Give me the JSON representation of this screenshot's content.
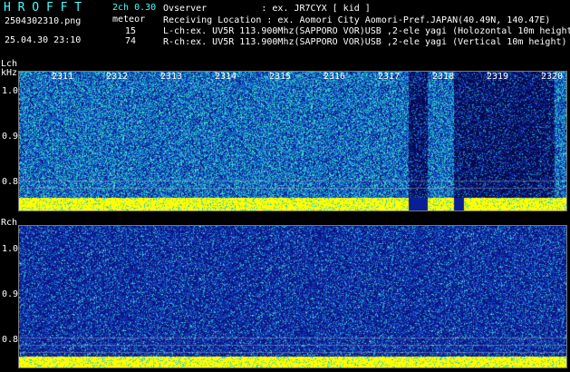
{
  "header": {
    "logo": "H R O F F T",
    "channel_version": "2ch 0.30",
    "mode_label": "meteor",
    "filename": "2504302310.png",
    "datetime": "25.04.30 23:10",
    "count_l": "15",
    "count_r": "74",
    "observer": "Ovserver          : ex. JR7CYX [ kid ]",
    "location": "Receiving Location : ex. Aomori City Aomori-Pref.JAPAN(40.49N, 140.47E)",
    "lch_info": "L-ch:ex. UV5R 113.900Mhz(SAPPORO VOR)USB ,2-ele yagi (Holozontal 10m height",
    "rch_info": "R-ch:ex. UV5R 113.900Mhz(SAPPORO VOR)USB ,2-ele yagi (Vertical 10m height)"
  },
  "lch_panel": {
    "channel_label": "Lch",
    "unit_label": "kHz",
    "time_ticks": [
      "2311",
      "2312",
      "2313",
      "2314",
      "2315",
      "2316",
      "2317",
      "2318",
      "2319",
      "2320"
    ],
    "freq_ticks": [
      "1.0",
      "0.9",
      "0.8"
    ]
  },
  "rch_panel": {
    "channel_label": "Rch",
    "freq_ticks": [
      "1.0",
      "0.9",
      "0.8"
    ]
  },
  "colors": {
    "background": "#000000",
    "cyan_text": "#44ffff",
    "noise_dark": "#0a1a8a",
    "noise_mid": "#1060d0",
    "noise_cyan": "#20c0c0",
    "baseline_yellow": "#ffff00"
  }
}
